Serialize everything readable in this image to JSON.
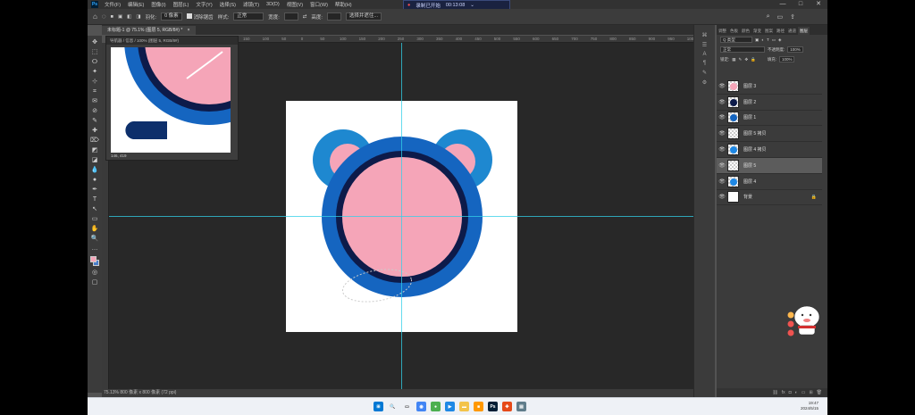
{
  "menu": {
    "items": [
      "文件(F)",
      "编辑(E)",
      "图像(I)",
      "图层(L)",
      "文字(Y)",
      "选择(S)",
      "滤镜(T)",
      "3D(D)",
      "视图(V)",
      "窗口(W)",
      "帮助(H)"
    ],
    "ps_logo": "Ps"
  },
  "recorder": {
    "text": "录制已开始",
    "time": "00:13:08"
  },
  "window_controls": {
    "minimize": "—",
    "maximize": "□",
    "close": "✕"
  },
  "options": {
    "feather_label": "羽化:",
    "feather_value": "0 像素",
    "antialias_label": "消除锯齿",
    "style_label": "样式:",
    "style_value": "正常",
    "width_label": "宽度:",
    "height_label": "高度:",
    "select_mask_button": "选择并遮住..."
  },
  "document": {
    "tab_label": "未标题-1 @ 75.1% (图层 5, RGB/8#) *",
    "tab_close": "×"
  },
  "ruler_top": [
    "150",
    "100",
    "50",
    "0",
    "50",
    "100",
    "150",
    "200",
    "250",
    "300",
    "350",
    "400",
    "450",
    "500",
    "550",
    "600",
    "650",
    "700",
    "750",
    "800",
    "850",
    "900",
    "950",
    "1000",
    "1050",
    "1100",
    "1150",
    "1200",
    "1250",
    "1300",
    "1350"
  ],
  "navigator": {
    "title": "导航器 / 信息 / 100% (图层 5, RGB/8#)",
    "coords": "146, 419"
  },
  "status": {
    "text": "75.13%   800 像素 x 800 像素 (72 ppi)"
  },
  "tools": [
    "✥",
    "⬚",
    "ⵔ",
    "✦",
    "⊹",
    "⌗",
    "✉",
    "⊘",
    "✎",
    "✚",
    "⌦",
    "◩",
    "◪",
    "💧",
    "●",
    "✒",
    "T",
    "↖",
    "▭",
    "✋",
    "🔍",
    "…"
  ],
  "panel": {
    "tabs": [
      "调整",
      "色板",
      "颜色",
      "渐变",
      "图案",
      "路径",
      "通道",
      "图层"
    ],
    "active_tab": "图层",
    "kind_label": "Q 类型",
    "blend_mode": "正常",
    "opacity_label": "不透明度:",
    "opacity_value": "100%",
    "lock_label": "锁定:",
    "fill_label": "填充:",
    "fill_value": "100%"
  },
  "layers": [
    {
      "name": "图层 3",
      "thumb": "#f5a5b8",
      "selected": false
    },
    {
      "name": "图层 2",
      "thumb": "#0d1b4a",
      "selected": false
    },
    {
      "name": "图层 1",
      "thumb": "#1565c0",
      "selected": false
    },
    {
      "name": "图层 5 拷贝",
      "thumb": "none",
      "selected": false
    },
    {
      "name": "图层 4 拷贝",
      "thumb": "#1e88e5",
      "selected": false
    },
    {
      "name": "图层 5",
      "thumb": "none",
      "selected": true
    },
    {
      "name": "图层 4",
      "thumb": "#1e88e5",
      "selected": false
    },
    {
      "name": "背景",
      "thumb": "white",
      "selected": false,
      "locked": true
    }
  ],
  "layer_lock_icon": "🔒",
  "panel_footer": [
    "⛓",
    "fx",
    "◘",
    "◐",
    "▭",
    "⊞",
    "🗑"
  ],
  "taskbar": {
    "icons": [
      "⊞",
      "🔍",
      "▭",
      "◉",
      "●",
      "▶",
      "▬",
      "■",
      "Ps",
      "✤",
      "▤"
    ],
    "icon_colors": [
      "#0078d4",
      "#333",
      "#333",
      "#4285f4",
      "#4caf50",
      "#1e88e5",
      "#f3c34a",
      "#ff9800",
      "#001e36",
      "#e64a19",
      "#607d8b"
    ],
    "time": "19:47",
    "date": "2024/5/15"
  },
  "colors": {
    "ear_outer": "#1e88d0",
    "ear_inner": "#f5a5b8",
    "ring_outer": "#1565c0",
    "ring_dark": "#0d1b4a",
    "face": "#f5a5b8",
    "guide": "#32d0e8",
    "foreground": "#f5a5b8",
    "background": "#4a7ec9"
  }
}
